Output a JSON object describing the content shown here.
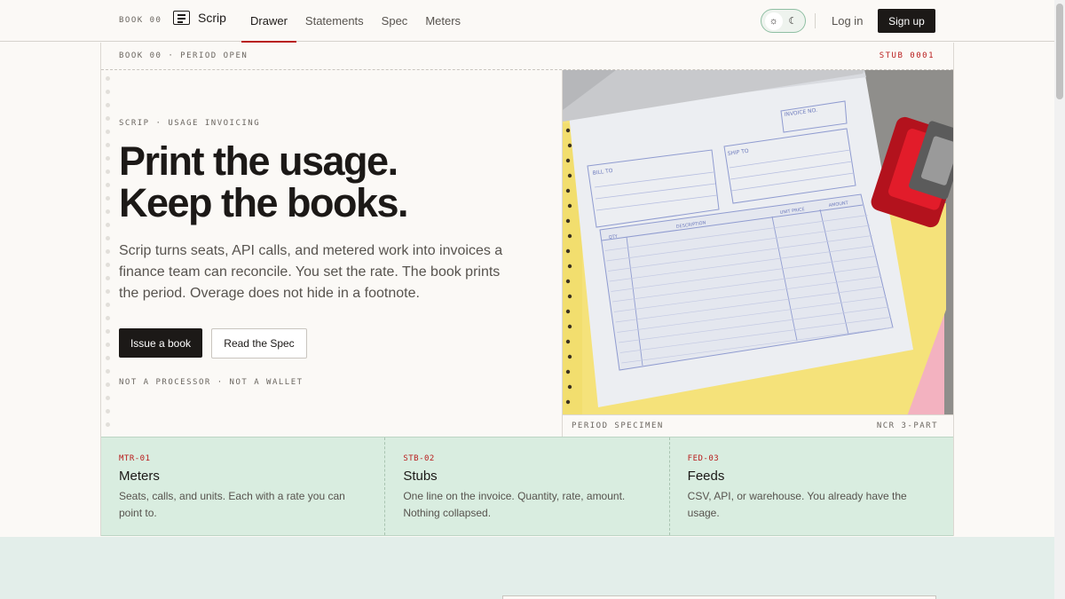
{
  "header": {
    "book_tag": "BOOK 00",
    "logo_text": "Scrip",
    "nav": [
      {
        "label": "Drawer",
        "active": true
      },
      {
        "label": "Statements",
        "active": false
      },
      {
        "label": "Spec",
        "active": false
      },
      {
        "label": "Meters",
        "active": false
      }
    ],
    "theme": {
      "light_icon": "sun-icon",
      "dark_icon": "moon-icon"
    },
    "login": "Log in",
    "signup": "Sign up"
  },
  "period_strip": {
    "left": "BOOK 00 · PERIOD OPEN",
    "right": "STUB 0001"
  },
  "hero": {
    "eyebrow": "SCRIP · USAGE INVOICING",
    "headline_1": "Print the usage.",
    "headline_2": "Keep the books.",
    "lede": "Scrip turns seats, API calls, and metered work into invoices a finance team can reconcile. You set the rate. The book prints the period. Overage does not hide in a footnote.",
    "primary_cta": "Issue a book",
    "secondary_cta": "Read the Spec",
    "disclaimer": "NOT A PROCESSOR · NOT A WALLET"
  },
  "specimen": {
    "caption_left": "PERIOD SPECIMEN",
    "caption_right": "NCR 3-PART",
    "form_labels": {
      "invoice_no": "INVOICE NO.",
      "bill_to": "BILL TO",
      "ship_to": "SHIP TO",
      "qty": "QTY",
      "description": "DESCRIPTION",
      "unit_price": "UNIT PRICE",
      "amount": "AMOUNT"
    }
  },
  "features": [
    {
      "code": "MTR-01",
      "title": "Meters",
      "desc": "Seats, calls, and units. Each with a rate you can point to."
    },
    {
      "code": "STB-02",
      "title": "Stubs",
      "desc": "One line on the invoice. Quantity, rate, amount. Nothing collapsed."
    },
    {
      "code": "FED-03",
      "title": "Feeds",
      "desc": "CSV, API, or warehouse. You already have the usage."
    }
  ],
  "colors": {
    "ink": "#1c1917",
    "accent_red": "#b91c1c",
    "feature_band": "#d9ede0",
    "paper": "#fbf9f6"
  }
}
